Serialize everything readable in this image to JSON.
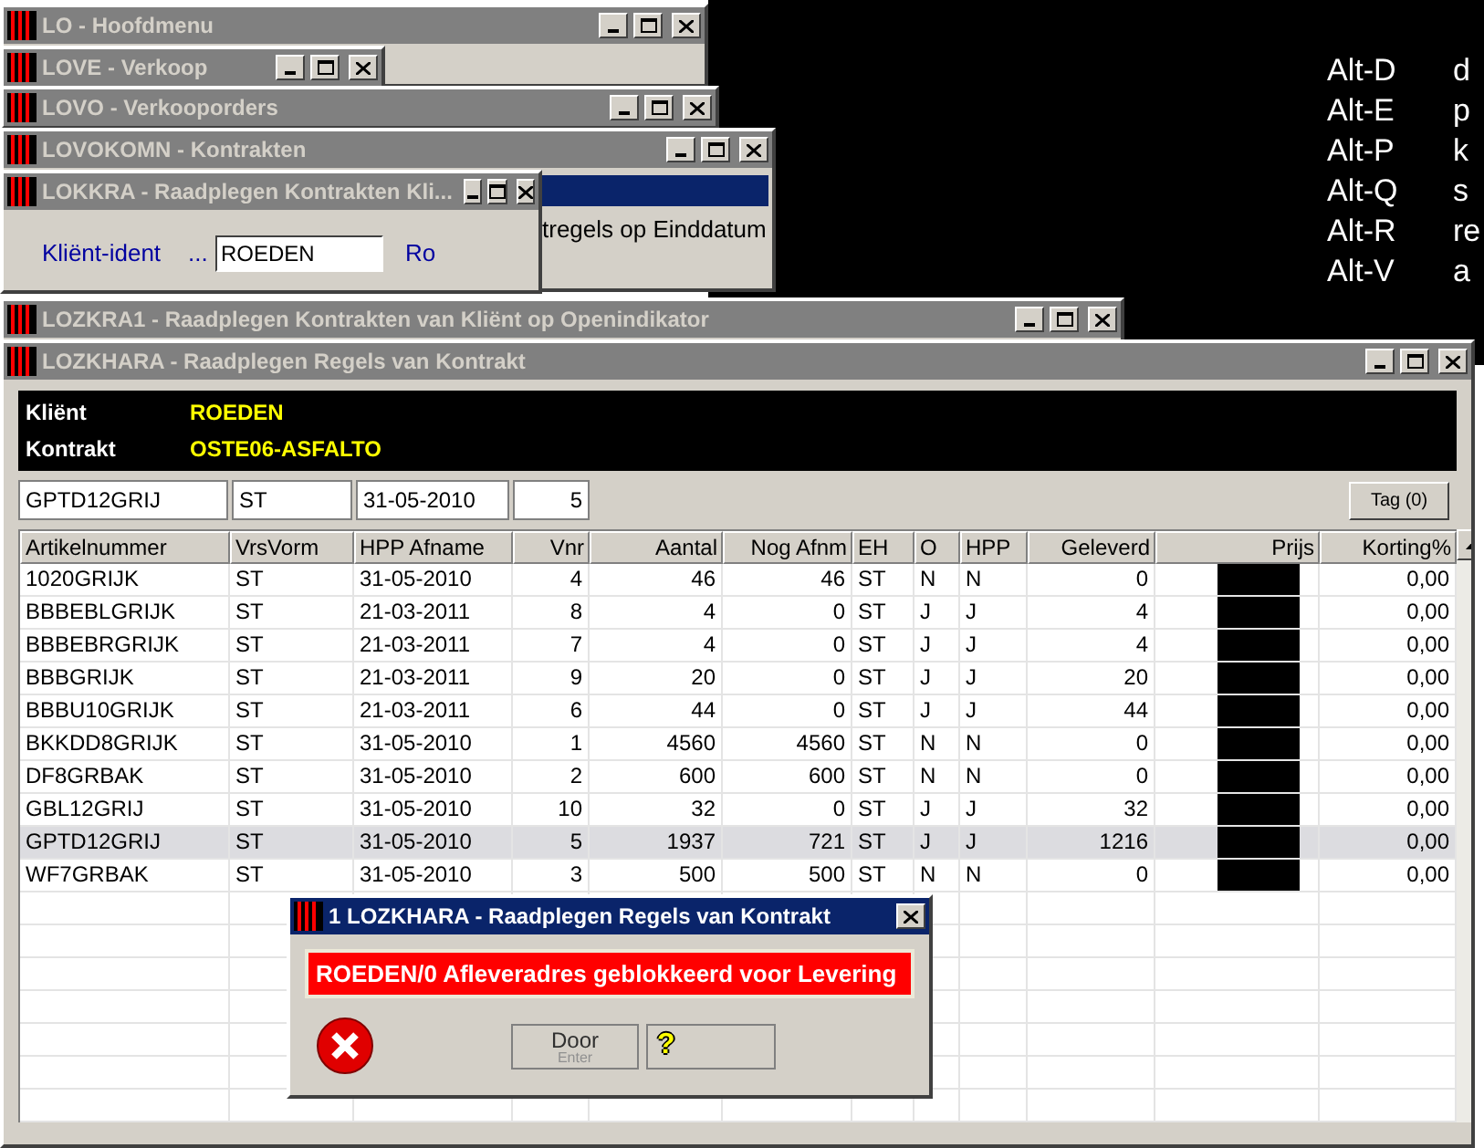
{
  "shortcuts": [
    {
      "key": "Alt-D",
      "text": "d"
    },
    {
      "key": "Alt-E",
      "text": "p"
    },
    {
      "key": "Alt-P",
      "text": "k"
    },
    {
      "key": "Alt-Q",
      "text": "s"
    },
    {
      "key": "Alt-R",
      "text": "re"
    },
    {
      "key": "Alt-V",
      "text": "a"
    }
  ],
  "windows": [
    {
      "title": "LO - Hoofdmenu"
    },
    {
      "title": "LOVE - Verkoop"
    },
    {
      "title": "LOVO - Verkooporders"
    },
    {
      "title": "LOVOKOMN - Kontrakten",
      "text": "tregels op Einddatum"
    },
    {
      "title": "LOKKRA - Raadplegen Kontrakten Kli...",
      "label": "Kliënt-ident",
      "dots": "...",
      "value": "ROEDEN",
      "hint": "Ro"
    },
    {
      "title": "LOZKRA1 - Raadplegen Kontrakten van Kliënt op Openindikator"
    }
  ],
  "main": {
    "title": "LOZKHARA - Raadplegen Regels van Kontrakt",
    "header": [
      {
        "label": "Kliënt",
        "value": "ROEDEN"
      },
      {
        "label": "Kontrakt",
        "value": "OSTE06-ASFALTO"
      }
    ],
    "filters": [
      "GPTD12GRIJ",
      "ST",
      "31-05-2010",
      "5"
    ],
    "tag_button": "Tag (0)",
    "table": {
      "columns": [
        "Artikelnummer",
        "VrsVorm",
        "HPP Afname",
        "Vnr",
        "Aantal",
        "Nog Afnm",
        "EH",
        "O",
        "HPP",
        "Geleverd",
        "Prijs",
        "Korting%"
      ],
      "rows": [
        {
          "cells": [
            "1020GRIJK",
            "ST",
            "31-05-2010",
            "4",
            "46",
            "46",
            "ST",
            "N",
            "N",
            "0",
            "0,00"
          ],
          "selected": false
        },
        {
          "cells": [
            "BBBEBLGRIJK",
            "ST",
            "21-03-2011",
            "8",
            "4",
            "0",
            "ST",
            "J",
            "J",
            "4",
            "0,00"
          ],
          "selected": false
        },
        {
          "cells": [
            "BBBEBRGRIJK",
            "ST",
            "21-03-2011",
            "7",
            "4",
            "0",
            "ST",
            "J",
            "J",
            "4",
            "0,00"
          ],
          "selected": false
        },
        {
          "cells": [
            "BBBGRIJK",
            "ST",
            "21-03-2011",
            "9",
            "20",
            "0",
            "ST",
            "J",
            "J",
            "20",
            "0,00"
          ],
          "selected": false
        },
        {
          "cells": [
            "BBBU10GRIJK",
            "ST",
            "21-03-2011",
            "6",
            "44",
            "0",
            "ST",
            "J",
            "J",
            "44",
            "0,00"
          ],
          "selected": false
        },
        {
          "cells": [
            "BKKDD8GRIJK",
            "ST",
            "31-05-2010",
            "1",
            "4560",
            "4560",
            "ST",
            "N",
            "N",
            "0",
            "0,00"
          ],
          "selected": false
        },
        {
          "cells": [
            "DF8GRBAK",
            "ST",
            "31-05-2010",
            "2",
            "600",
            "600",
            "ST",
            "N",
            "N",
            "0",
            "0,00"
          ],
          "selected": false
        },
        {
          "cells": [
            "GBL12GRIJ",
            "ST",
            "31-05-2010",
            "10",
            "32",
            "0",
            "ST",
            "J",
            "J",
            "32",
            "0,00"
          ],
          "selected": false
        },
        {
          "cells": [
            "GPTD12GRIJ",
            "ST",
            "31-05-2010",
            "5",
            "1937",
            "721",
            "ST",
            "J",
            "J",
            "1216",
            "0,00"
          ],
          "selected": true
        },
        {
          "cells": [
            "WF7GRBAK",
            "ST",
            "31-05-2010",
            "3",
            "500",
            "500",
            "ST",
            "N",
            "N",
            "0",
            "0,00"
          ],
          "selected": false
        }
      ]
    }
  },
  "dialog": {
    "title": "1 LOZKHARA - Raadplegen Regels van Kontrakt",
    "message": "ROEDEN/0 Afleveradres geblokkeerd voor Levering",
    "buttons": [
      {
        "kind": "action",
        "label": "Door",
        "sub": "Enter"
      },
      {
        "kind": "help",
        "label": "?"
      }
    ]
  }
}
